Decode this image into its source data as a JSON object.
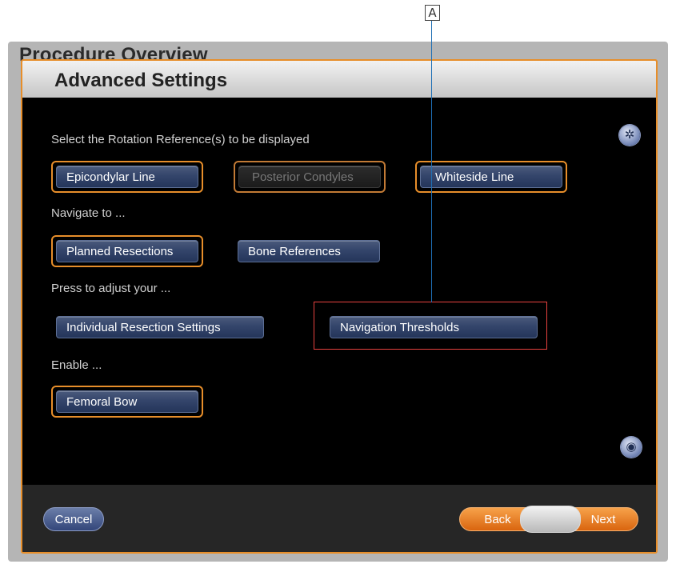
{
  "callout": {
    "label": "A"
  },
  "background_window": {
    "title": "Procedure Overview"
  },
  "dialog": {
    "title": "Advanced Settings",
    "rotation_prompt": "Select the Rotation Reference(s) to be displayed",
    "rotation_buttons": [
      {
        "label": "Epicondylar Line",
        "selected": true,
        "enabled": true
      },
      {
        "label": "Posterior Condyles",
        "selected": true,
        "enabled": false
      },
      {
        "label": "Whiteside Line",
        "selected": true,
        "enabled": true
      }
    ],
    "navigate_prompt": "Navigate to ...",
    "navigate_buttons": [
      {
        "label": "Planned Resections",
        "selected": true
      },
      {
        "label": "Bone References",
        "selected": false
      }
    ],
    "adjust_prompt": "Press to adjust your ...",
    "adjust_buttons": [
      {
        "label": "Individual Resection Settings"
      },
      {
        "label": "Navigation Thresholds",
        "highlighted": true
      }
    ],
    "enable_prompt": "Enable ...",
    "enable_buttons": [
      {
        "label": "Femoral Bow",
        "selected": true
      }
    ],
    "icons": {
      "settings": "gear-icon",
      "screenshot": "camera-icon"
    }
  },
  "footer": {
    "cancel_label": "Cancel",
    "back_label": "Back",
    "next_label": "Next"
  },
  "colors": {
    "accent_orange": "#e78e2a",
    "button_blue": "#34456b",
    "highlight_red": "#e8423f",
    "callout_line": "#1f6fb4"
  }
}
